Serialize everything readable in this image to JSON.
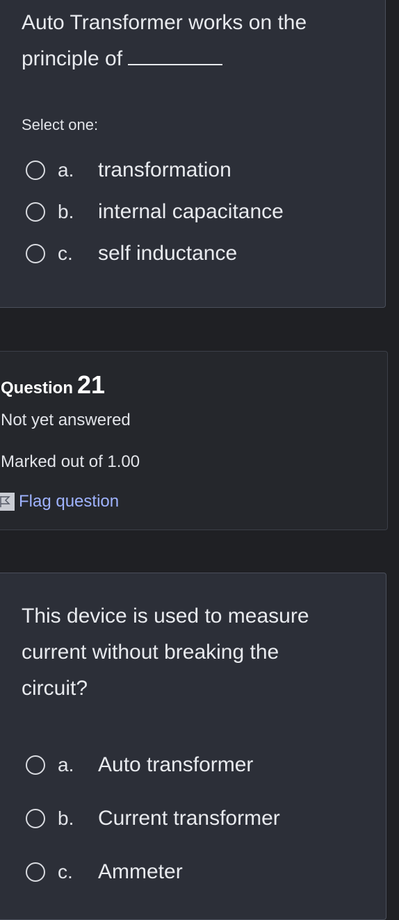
{
  "question20": {
    "text_line1": "Auto Transformer works on the",
    "text_line2": "principle of",
    "select_label": "Select one:",
    "options": [
      {
        "letter": "a.",
        "text": "transformation"
      },
      {
        "letter": "b.",
        "text": "internal capacitance"
      },
      {
        "letter": "c.",
        "text": "self inductance"
      }
    ]
  },
  "question21_info": {
    "label": "Question",
    "number": "21",
    "status": "Not yet answered",
    "marks": "Marked out of 1.00",
    "flag_label": "Flag question"
  },
  "question21": {
    "text_line1": "This device is used to measure",
    "text_line2": "current without breaking the",
    "text_line3": "circuit?",
    "options": [
      {
        "letter": "a.",
        "text": "Auto transformer"
      },
      {
        "letter": "b.",
        "text": "Current transformer"
      },
      {
        "letter": "c.",
        "text": "Ammeter"
      }
    ]
  },
  "colors": {
    "card_bg": "#2c2f38",
    "page_bg": "#1f2024",
    "link": "#9fb3ff"
  }
}
